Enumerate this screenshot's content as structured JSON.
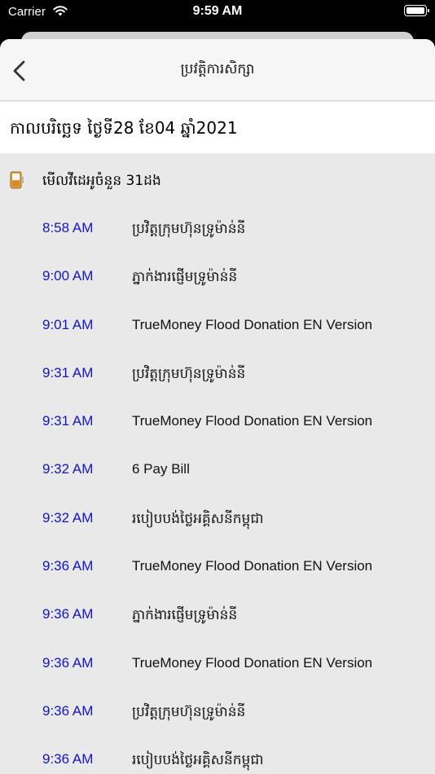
{
  "status_bar": {
    "carrier": "Carrier",
    "time": "9:59 AM"
  },
  "nav": {
    "title": "ប្រវត្តិការសិក្សា",
    "back_icon": "chevron-left-icon"
  },
  "date_label": "កាលបរិច្ឆេទ ថ្ងៃទី28 ខែ04 ឆ្នាំ2021",
  "summary": {
    "icon": "phone-battery-icon",
    "label": "មើលវីដេអូចំនួន 31ដង"
  },
  "colors": {
    "time_text": "#1414c8",
    "sheet_bg": "#e9e9e9"
  },
  "items": [
    {
      "time": "8:58 AM",
      "title": "ប្រវិត្តក្រុមហ៊ុនទ្រូម៉ាន់នី"
    },
    {
      "time": "9:00 AM",
      "title": "ភ្នាក់ងារផ្ញើមទ្រូម៉ាន់នី"
    },
    {
      "time": "9:01 AM",
      "title": "TrueMoney Flood Donation EN Version"
    },
    {
      "time": "9:31 AM",
      "title": "ប្រវិត្តក្រុមហ៊ុនទ្រូម៉ាន់នី"
    },
    {
      "time": "9:31 AM",
      "title": "TrueMoney Flood Donation EN Version"
    },
    {
      "time": "9:32 AM",
      "title": "6 Pay Bill"
    },
    {
      "time": "9:32 AM",
      "title": "របៀបបង់ថ្លៃអគ្គិសនីកម្ពុជា"
    },
    {
      "time": "9:36 AM",
      "title": "TrueMoney Flood Donation EN Version"
    },
    {
      "time": "9:36 AM",
      "title": "ភ្នាក់ងារផ្ញើមទ្រូម៉ាន់នី"
    },
    {
      "time": "9:36 AM",
      "title": "TrueMoney Flood Donation EN Version"
    },
    {
      "time": "9:36 AM",
      "title": "ប្រវិត្តក្រុមហ៊ុនទ្រូម៉ាន់នី"
    },
    {
      "time": "9:36 AM",
      "title": "របៀបបង់ថ្លៃអគ្គិសនីកម្ពុជា"
    }
  ]
}
